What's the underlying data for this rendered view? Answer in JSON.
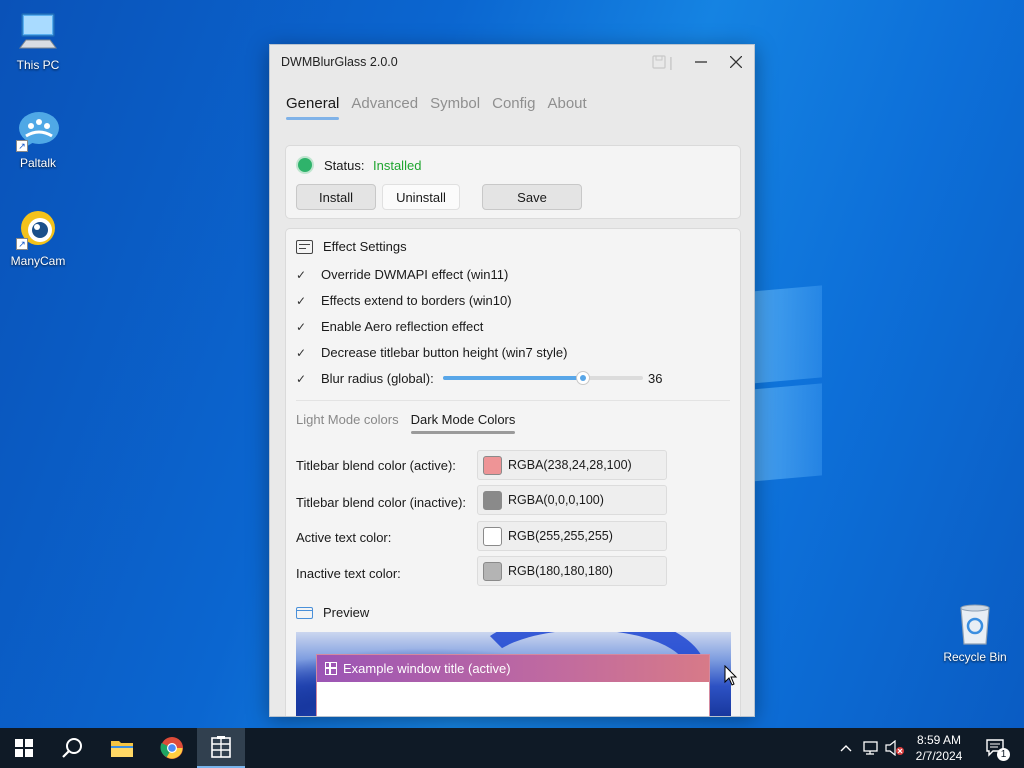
{
  "desktop": {
    "icons": [
      {
        "label": "This PC",
        "icon": "computer-icon"
      },
      {
        "label": "Paltalk",
        "icon": "paltalk-icon"
      },
      {
        "label": "ManyCam",
        "icon": "manycam-icon"
      },
      {
        "label": "Recycle Bin",
        "icon": "recycle-bin-icon"
      }
    ]
  },
  "window": {
    "title": "DWMBlurGlass 2.0.0",
    "tabs": [
      "General",
      "Advanced",
      "Symbol",
      "Config",
      "About"
    ],
    "active_tab": "General"
  },
  "status": {
    "label": "Status:",
    "value": "Installed",
    "value_color": "#1fa52f",
    "buttons": {
      "install": "Install",
      "uninstall": "Uninstall",
      "save": "Save"
    }
  },
  "effect_settings": {
    "heading": "Effect Settings",
    "options": [
      {
        "label": "Override DWMAPI effect (win11)",
        "checked": true
      },
      {
        "label": "Effects extend to borders (win10)",
        "checked": true
      },
      {
        "label": "Enable Aero reflection effect",
        "checked": true
      },
      {
        "label": "Decrease titlebar button height (win7 style)",
        "checked": true
      }
    ],
    "blur": {
      "label": "Blur radius (global):",
      "checked": true,
      "value": "36",
      "fraction": 0.7
    }
  },
  "color_tabs": {
    "light": "Light Mode colors",
    "dark": "Dark Mode Colors",
    "active": "dark"
  },
  "colors": [
    {
      "label": "Titlebar blend color (active):",
      "value": "RGBA(238,24,28,100)",
      "swatch": "#ee9496"
    },
    {
      "label": "Titlebar blend color (inactive):",
      "value": "RGBA(0,0,0,100)",
      "swatch": "#8a8a8a"
    },
    {
      "label": "Active text color:",
      "value": "RGB(255,255,255)",
      "swatch": "#ffffff"
    },
    {
      "label": "Inactive text color:",
      "value": "RGB(180,180,180)",
      "swatch": "#b4b4b4"
    }
  ],
  "preview": {
    "heading": "Preview",
    "example_title": "Example window title (active)"
  },
  "taskbar": {
    "clock_time": "8:59 AM",
    "clock_date": "2/7/2024",
    "notification_count": "1"
  }
}
